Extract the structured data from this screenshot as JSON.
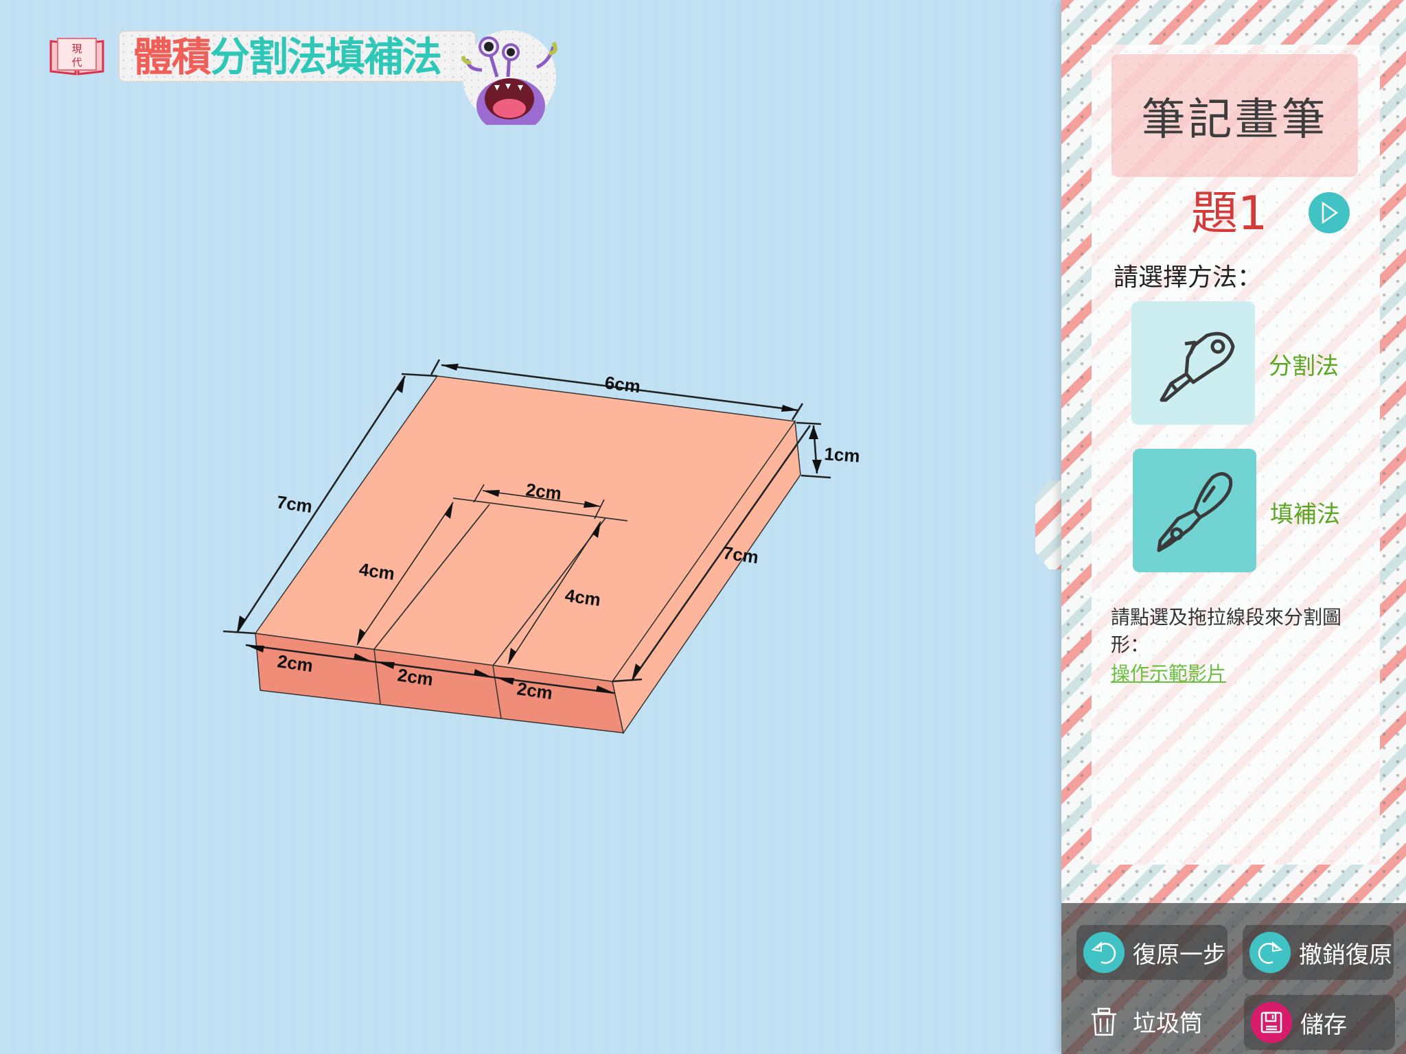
{
  "header": {
    "brand_text": "現代",
    "title_part1": "體積",
    "title_part2": "分割法填補法",
    "brand_icon": "book-icon",
    "mascot_icon": "monster-mascot-icon"
  },
  "diagram": {
    "shape": "rectangular prism with rectangular notch",
    "labels": {
      "top_width": "6cm",
      "left_length": "7cm",
      "right_length": "7cm",
      "height": "1cm",
      "notch_width": "2cm",
      "notch_depth_left": "4cm",
      "notch_depth_right": "4cm",
      "front_segment_1": "2cm",
      "front_segment_2": "2cm",
      "front_segment_3": "2cm"
    },
    "colors": {
      "top_face": "#fdb59b",
      "front_face": "#f08d78",
      "side_face": "#fdb59b",
      "background": "#c2e1f3"
    }
  },
  "panel": {
    "header_title": "筆記畫筆",
    "question_label": "題1",
    "next_icon": "play-next-icon",
    "choose_label": "請選擇方法：",
    "methods": [
      {
        "label": "分割法",
        "icon": "utility-knife-icon",
        "selected": false
      },
      {
        "label": "填補法",
        "icon": "fountain-pen-icon",
        "selected": true
      }
    ],
    "instruction": "請點選及拖拉線段來分割圖形：",
    "demo_link": "操作示範影片"
  },
  "toolbar": {
    "undo_label": "復原一步",
    "redo_label": "撤銷復原",
    "trash_label": "垃圾筒",
    "save_label": "儲存"
  },
  "colors": {
    "accent_teal": "#41c2c4",
    "accent_red": "#d33a3a",
    "method_green": "#5aa71f",
    "save_magenta": "#d81b6a"
  }
}
